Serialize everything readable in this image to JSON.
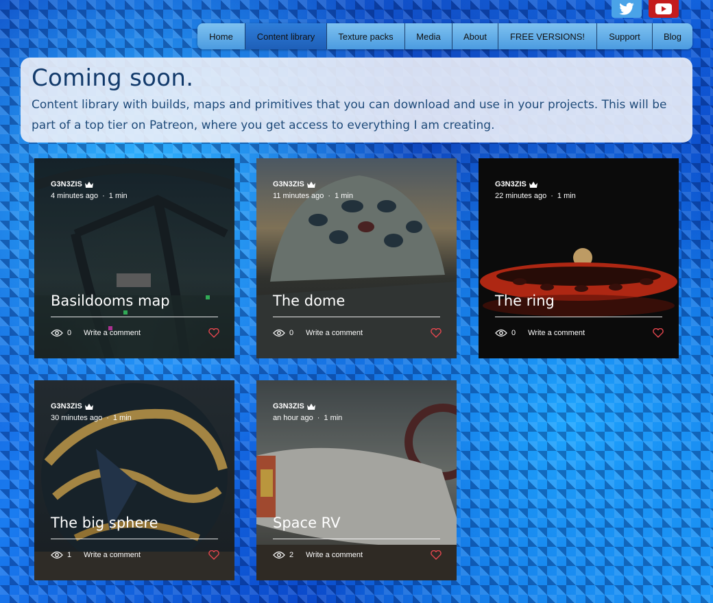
{
  "social": {
    "twitter": "twitter-icon",
    "youtube": "youtube-icon"
  },
  "nav": {
    "items": [
      {
        "label": "Home"
      },
      {
        "label": "Content library"
      },
      {
        "label": "Texture packs"
      },
      {
        "label": "Media"
      },
      {
        "label": "About"
      },
      {
        "label": "FREE VERSIONS!"
      },
      {
        "label": "Support"
      },
      {
        "label": "Blog"
      }
    ],
    "active_index": 1
  },
  "banner": {
    "title": "Coming soon.",
    "text": "Content library with builds, maps and primitives that you can download and use in your projects.  This will be part of a top tier on Patreon, where you get access to everything I am creating."
  },
  "posts": [
    {
      "author": "G3N3ZIS",
      "time": "4 minutes ago",
      "read": "1 min",
      "title": "Basildooms map",
      "views": "0",
      "comment_label": "Write a comment"
    },
    {
      "author": "G3N3ZIS",
      "time": "11 minutes ago",
      "read": "1 min",
      "title": "The dome",
      "views": "0",
      "comment_label": "Write a comment"
    },
    {
      "author": "G3N3ZIS",
      "time": "22 minutes ago",
      "read": "1 min",
      "title": "The ring",
      "views": "0",
      "comment_label": "Write a comment"
    },
    {
      "author": "G3N3ZIS",
      "time": "30 minutes ago",
      "read": "1 min",
      "title": "The big sphere",
      "views": "1",
      "comment_label": "Write a comment"
    },
    {
      "author": "G3N3ZIS",
      "time": "an hour ago",
      "read": "1 min",
      "title": "Space RV",
      "views": "2",
      "comment_label": "Write a comment"
    }
  ],
  "colors": {
    "heart": "#e8474f",
    "nav_active": "#1e5fb8",
    "banner_text": "#1f4b7a"
  }
}
